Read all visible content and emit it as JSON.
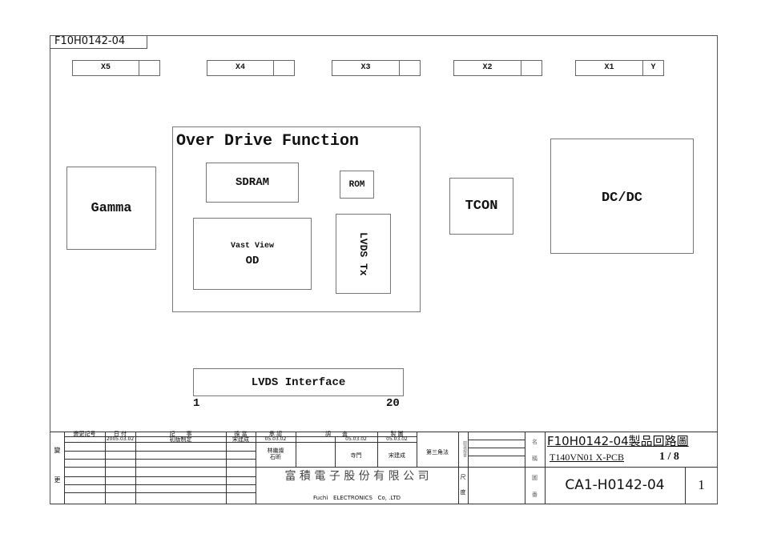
{
  "sheet": {
    "label": "F10H0142-04"
  },
  "connectors": [
    {
      "name": "X5",
      "pin": ""
    },
    {
      "name": "X4",
      "pin": ""
    },
    {
      "name": "X3",
      "pin": ""
    },
    {
      "name": "X2",
      "pin": ""
    },
    {
      "name": "X1",
      "pin": "Y"
    }
  ],
  "blocks": {
    "gamma": "Gamma",
    "over_drive_title": "Over Drive Function",
    "sdram": "SDRAM",
    "rom": "ROM",
    "vast_view": "Vast View",
    "od": "OD",
    "lvds_tx": "LVDS Tx",
    "tcon": "TCON",
    "dcdc": "DC/DC",
    "lvds_interface": "LVDS Interface",
    "lvds_pin_start": "1",
    "lvds_pin_end": "20"
  },
  "title_block": {
    "side_label_top": "變",
    "side_label_bottom": "更",
    "headers": {
      "change_no": "變更記号",
      "date": "日 付",
      "description": "記　　事",
      "in_charge": "擔 當",
      "approve": "承 認",
      "check": "調　　査",
      "draw": "製 圖"
    },
    "revision_row": {
      "date": "2005.03.02",
      "description": "初版制定",
      "in_charge": "宋建成"
    },
    "dates": {
      "approve": "05.03.02",
      "check": "05.03.02",
      "draw": "05.03.02"
    },
    "names": {
      "approve": "林繼燦\n石昕",
      "check": "寺門",
      "draw": "宋建成"
    },
    "projection": "第三角法",
    "related_label": "關連規番",
    "scale_label_1": "尺",
    "scale_label_2": "度",
    "name_label_1": "名",
    "name_label_2": "稱",
    "drawing_no_label_1": "圖",
    "drawing_no_label_2": "番",
    "company_cn": "富 積 電 子 股 份 有 限 公 司",
    "company_en": "Fuchi   ELECTRONICS   Co, .LTD",
    "drawing_title": "F10H0142-04製品回路圖",
    "drawing_subtitle": "T140VN01  X-PCB",
    "page": "1 / 8",
    "drawing_number": "CA1-H0142-04",
    "revision": "1"
  }
}
